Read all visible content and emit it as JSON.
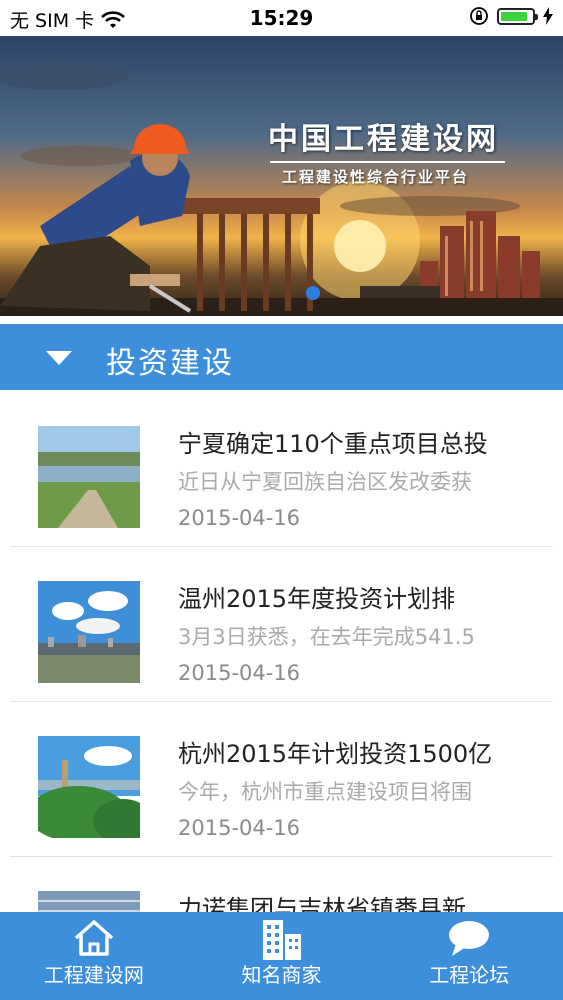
{
  "status_bar": {
    "carrier": "无 SIM 卡",
    "time": "15:29",
    "battery_level": 0.85
  },
  "banner": {
    "title": "中国工程建设网",
    "subtitle": "工程建设性综合行业平台",
    "page_index": 1
  },
  "section": {
    "title": "投资建设",
    "icon": "triangle-down-icon"
  },
  "news": [
    {
      "title": "宁夏确定110个重点项目总投",
      "snippet": "近日从宁夏回族自治区发改委获",
      "date": "2015-04-16"
    },
    {
      "title": "温州2015年度投资计划排",
      "snippet": "3月3日获悉，在去年完成541.5",
      "date": "2015-04-16"
    },
    {
      "title": "杭州2015年计划投资1500亿",
      "snippet": "今年，杭州市重点建设项目将围",
      "date": "2015-04-16"
    },
    {
      "title": "力诺集团与吉林省镇赉县新",
      "snippet": "",
      "date": ""
    }
  ],
  "tabs": [
    {
      "label": "工程建设网",
      "icon": "home-icon"
    },
    {
      "label": "知名商家",
      "icon": "buildings-icon"
    },
    {
      "label": "工程论坛",
      "icon": "chat-bubble-icon"
    }
  ],
  "colors": {
    "accent": "#3d8fdc",
    "page_dot": "#2a7fe0",
    "battery": "#3cd43c"
  }
}
